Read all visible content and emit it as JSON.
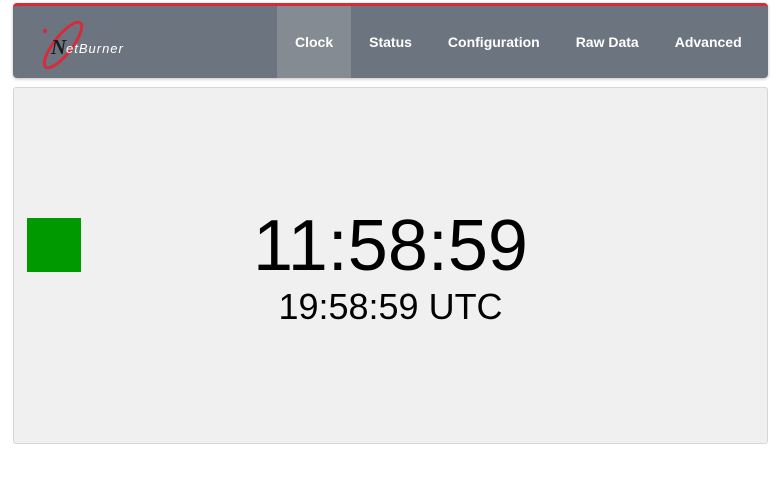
{
  "brand": {
    "logo_letter": "N",
    "logo_text": "etBurner",
    "logo_color": "#d62b3a"
  },
  "colors": {
    "navbar_bg": "#6c757f",
    "navbar_accent": "#d62b3a",
    "active_tab_bg": "#858b92",
    "status_indicator": "#009900"
  },
  "nav": {
    "items": [
      {
        "label": "Clock",
        "active": true
      },
      {
        "label": "Status",
        "active": false
      },
      {
        "label": "Configuration",
        "active": false
      },
      {
        "label": "Raw Data",
        "active": false
      },
      {
        "label": "Advanced",
        "active": false
      }
    ]
  },
  "clock": {
    "local_time": "11:58:59",
    "utc_time": "19:58:59 UTC",
    "status_indicator_icon": "green-square-icon"
  }
}
